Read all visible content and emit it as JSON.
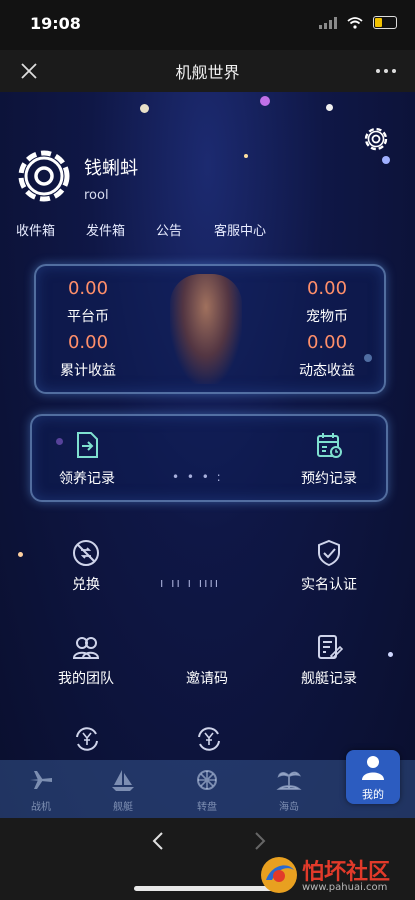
{
  "status": {
    "time": "19:08"
  },
  "titlebar": {
    "title": "机舰世界"
  },
  "profile": {
    "username": "钱蜊蚪",
    "user_id": "rool"
  },
  "quick_links": [
    "收件箱",
    "发件箱",
    "公告",
    "客服中心"
  ],
  "balances": {
    "platform_coin": {
      "value": "0.00",
      "label": "平台币"
    },
    "pet_coin": {
      "value": "0.00",
      "label": "宠物币"
    },
    "total_income": {
      "value": "0.00",
      "label": "累计收益"
    },
    "dynamic_income": {
      "value": "0.00",
      "label": "动态收益"
    }
  },
  "records": {
    "adopt": "领养记录",
    "reserve": "预约记录",
    "middle_partial": "• • • :"
  },
  "grid": {
    "exchange": "兑换",
    "middle_partial": "ı ıı ı ıııı",
    "real_name": "实名认证",
    "team": "我的团队",
    "invite": "邀请码",
    "ship_records": "舰艇记录"
  },
  "tabs": [
    "战机",
    "舰艇",
    "转盘",
    "海岛",
    "我的"
  ],
  "watermark": {
    "text": "怕坏社区",
    "url": "www.pahuai.com"
  },
  "colors": {
    "value_orange": "#ff8f6a",
    "active_tab": "#2c5cc0",
    "background": "#0f1746"
  }
}
